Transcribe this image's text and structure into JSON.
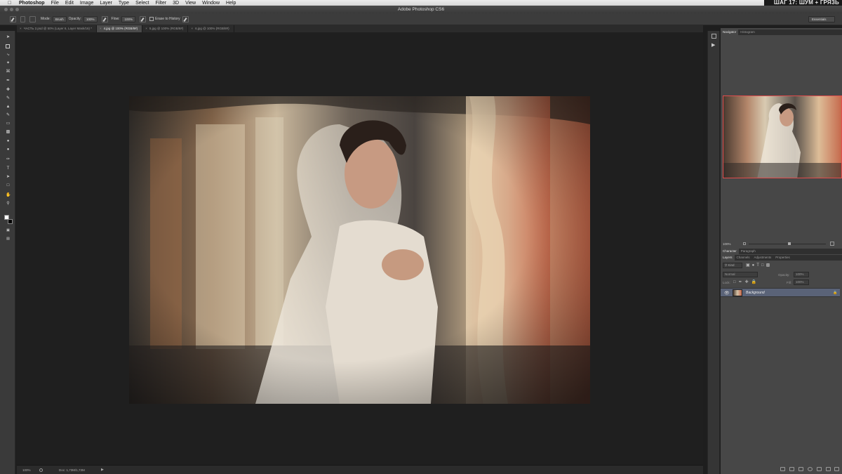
{
  "menubar": {
    "app_name": "Photoshop",
    "items": [
      "File",
      "Edit",
      "Image",
      "Layer",
      "Type",
      "Select",
      "Filter",
      "3D",
      "View",
      "Window",
      "Help"
    ],
    "caption": "ШАГ 17: ШУМ + ГРЯЗЬ"
  },
  "window": {
    "title": "Adobe Photoshop CS6"
  },
  "options": {
    "mode_label": "Mode:",
    "mode_value": "Brush",
    "opacity_label": "Opacity:",
    "opacity_value": "100%",
    "flow_label": "Flow:",
    "flow_value": "100%",
    "erase_history": "Erase to History",
    "workspace": "Essentials"
  },
  "tabs": [
    {
      "label": "ЧАСТЬ 2.psd @ 50% (Layer 6, Layer Mask/16) *",
      "active": false
    },
    {
      "label": "4.jpg @ 100% (RGB/8#)",
      "active": true
    },
    {
      "label": "5.jpg @ 100% (RGB/8#)",
      "active": false
    },
    {
      "label": "6.jpg @ 100% (RGB/8#)",
      "active": false
    }
  ],
  "status": {
    "zoom": "100%",
    "doc": "Doc: 1,73M/1,73M"
  },
  "panels": {
    "top_tabs": [
      "Navigator",
      "Histogram"
    ],
    "nav_zoom": "100%",
    "char_tabs": [
      "Character",
      "Paragraph"
    ],
    "layer_tabs": [
      "Layers",
      "Channels",
      "Adjustments",
      "Properties"
    ],
    "kind_label": "Kind",
    "blend_mode": "Normal",
    "opacity_label": "Opacity:",
    "opacity_value": "100%",
    "lock_label": "Lock:",
    "fill_label": "Fill:",
    "fill_value": "100%",
    "layer_name": "Background"
  },
  "colors": {
    "menubar": "#dcdcdc",
    "chrome": "#3c3c3c",
    "canvas_bg": "#1f1f1f",
    "panel": "#474747",
    "nav_border": "#e24c4c",
    "layer_selected": "#5a6378"
  },
  "icons": [
    "apple-icon",
    "move-tool-icon",
    "marquee-tool-icon",
    "lasso-tool-icon",
    "quick-select-tool-icon",
    "crop-tool-icon",
    "eyedropper-tool-icon",
    "healing-brush-icon",
    "brush-tool-icon",
    "clone-stamp-icon",
    "history-brush-icon",
    "eraser-tool-icon",
    "gradient-tool-icon",
    "blur-tool-icon",
    "dodge-tool-icon",
    "pen-tool-icon",
    "type-tool-icon",
    "path-select-icon",
    "shape-tool-icon",
    "hand-tool-icon",
    "zoom-tool-icon",
    "eye-icon",
    "lock-icon"
  ]
}
